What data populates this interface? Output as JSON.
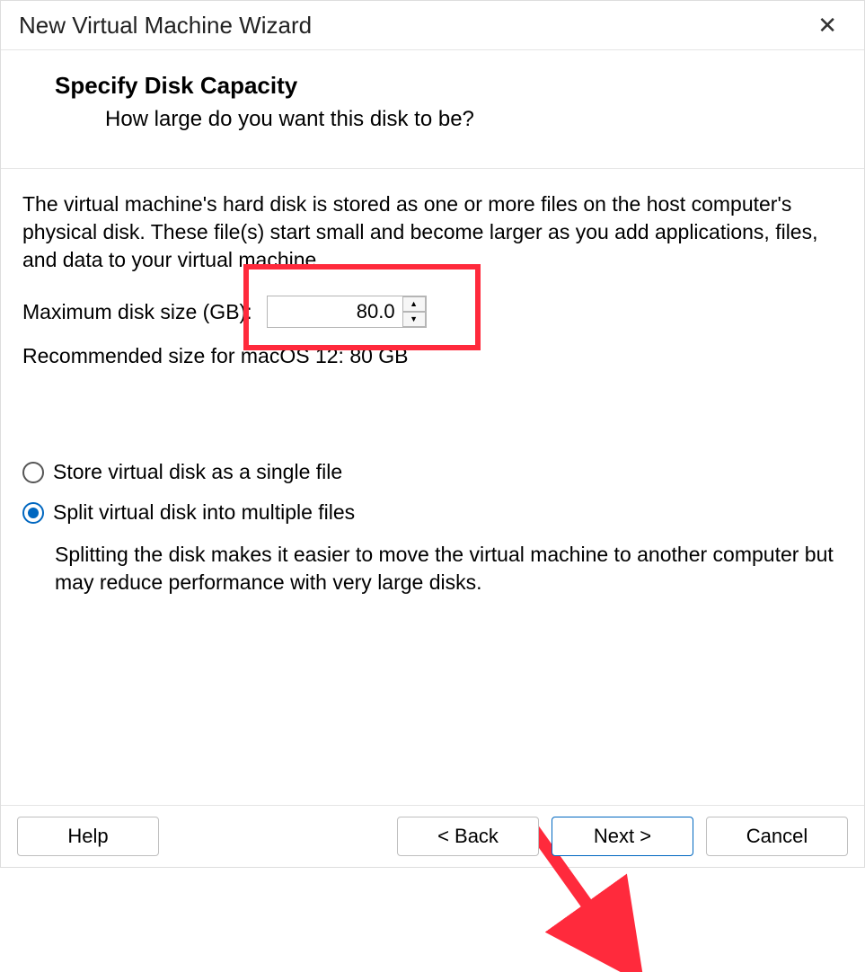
{
  "titlebar": {
    "title": "New Virtual Machine Wizard",
    "close_glyph": "✕"
  },
  "header": {
    "heading": "Specify Disk Capacity",
    "subheading": "How large do you want this disk to be?"
  },
  "body": {
    "description": "The virtual machine's hard disk is stored as one or more files on the host computer's physical disk. These file(s) start small and become larger as you add applications, files, and data to your virtual machine.",
    "disk_size_label": "Maximum disk size (GB):",
    "disk_size_value": "80.0",
    "recommended": "Recommended size for macOS 12: 80 GB"
  },
  "options": {
    "single_file": "Store virtual disk as a single file",
    "split_files": "Split virtual disk into multiple files",
    "split_description": "Splitting the disk makes it easier to move the virtual machine to another computer but may reduce performance with very large disks.",
    "selected": "split_files"
  },
  "footer": {
    "help": "Help",
    "back": "< Back",
    "next": "Next >",
    "cancel": "Cancel"
  },
  "annotations": {
    "highlight_color": "#ff2a3c",
    "arrow_color": "#ff2a3c"
  }
}
